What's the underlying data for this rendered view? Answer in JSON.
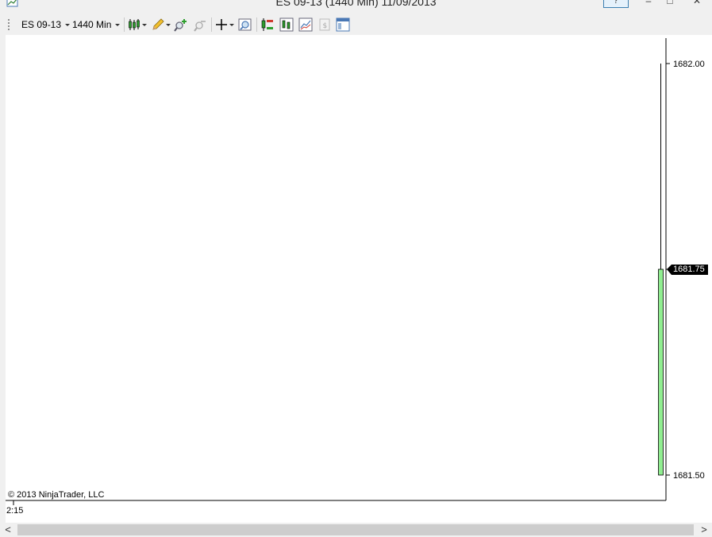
{
  "window": {
    "title": "ES 09-13 (1440 Min)  11/09/2013",
    "help_label": "?",
    "minimize_label": "–",
    "maximize_label": "□",
    "close_label": "✕"
  },
  "toolbar": {
    "instrument": "ES 09-13",
    "interval": "1440 Min",
    "icons": [
      "chart-style-icon",
      "drawing-tools-icon",
      "zoom-in-icon",
      "zoom-out-icon",
      "crosshair-icon",
      "data-box-icon",
      "strategies-icon",
      "indicators-icon",
      "properties-icon",
      "chart-trader-icon",
      "templates-icon"
    ]
  },
  "chart": {
    "copyright": "© 2013 NinjaTrader, LLC",
    "time_label": "2:15",
    "price_axis": {
      "ticks": [
        "1682.00",
        "1681.75",
        "1681.50"
      ]
    },
    "last_price": "1681.75",
    "colors": {
      "up_bar": "#90ee90",
      "bar_outline": "#000000",
      "marker_bg": "#000000",
      "marker_text": "#ffffff"
    }
  },
  "chart_data": {
    "type": "bar",
    "instrument": "ES 09-13",
    "interval": "1440 Min",
    "candles": [
      {
        "time": "2:15",
        "open": 1681.5,
        "high": 1682.0,
        "low": 1681.5,
        "close": 1681.75
      }
    ],
    "y_ticks": [
      1681.5,
      1681.75,
      1682.0
    ],
    "ylim": [
      1681.5,
      1682.0
    ],
    "last_price": 1681.75
  },
  "scrollbar": {
    "left_label": "<",
    "right_label": ">"
  }
}
